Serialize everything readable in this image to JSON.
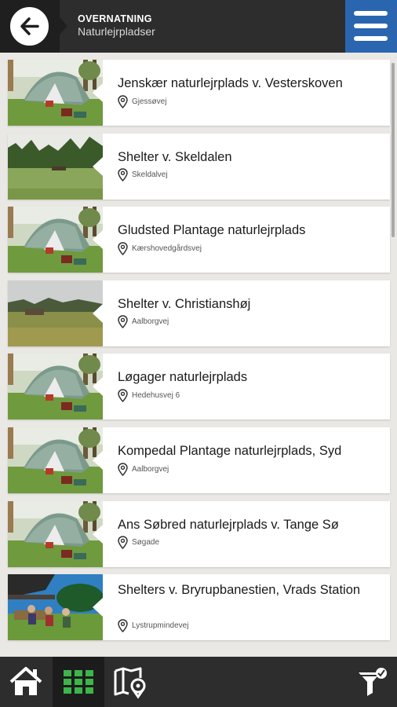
{
  "header": {
    "title": "OVERNATNING",
    "subtitle": "Naturlejrpladser"
  },
  "items": [
    {
      "title": "Jenskær naturlejrplads v. Vesterskoven",
      "location": "Gjessøvej",
      "photo": "tent"
    },
    {
      "title": "Shelter v. Skeldalen",
      "location": "Skeldalvej",
      "photo": "meadow"
    },
    {
      "title": "Gludsted Plantage naturlejrplads",
      "location": "Kærshovedgårdsvej",
      "photo": "tent"
    },
    {
      "title": "Shelter v. Christianshøj",
      "location": "Aalborgvej",
      "photo": "field"
    },
    {
      "title": "Løgager naturlejrplads",
      "location": "Hedehusvej 6",
      "photo": "tent"
    },
    {
      "title": "Kompedal Plantage naturlejrplads, Syd",
      "location": "Aalborgvej",
      "photo": "tent"
    },
    {
      "title": "Ans Søbred naturlejrplads v. Tange Sø",
      "location": "Søgade",
      "photo": "tent"
    },
    {
      "title": "Shelters v. Bryrupbanestien, Vrads Station",
      "location": "Lystrupmindevej",
      "photo": "shelter"
    }
  ],
  "bottombar": {
    "tabs": [
      "home-icon",
      "grid-icon",
      "map-pin-icon",
      "filter-icon"
    ],
    "active_tab": "grid-icon",
    "active_color": "#3cb54a"
  },
  "colors": {
    "header_bg": "#2d2d2d",
    "menu_bg": "#2a66b0",
    "list_bg": "#e9e8e4"
  }
}
